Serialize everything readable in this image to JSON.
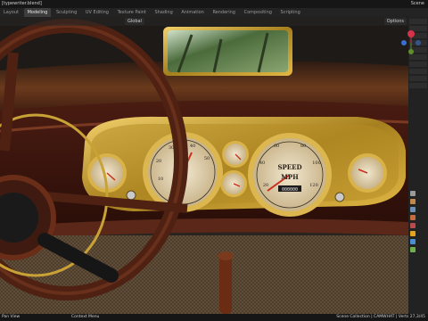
{
  "window": {
    "title": "[typewriter.blend]",
    "scene_label": "Scene"
  },
  "tabs": [
    "Layout",
    "Modeling",
    "Sculpting",
    "UV Editing",
    "Texture Paint",
    "Shading",
    "Animation",
    "Rendering",
    "Compositing",
    "Scripting"
  ],
  "active_tab": "Modeling",
  "viewport_header": {
    "orientation": "Global",
    "options": "Options"
  },
  "gauges": {
    "speed_top": "SPEED",
    "speed_bottom": "MPH",
    "odometer": "000000",
    "speed_ticks": [
      "20",
      "40",
      "60",
      "80",
      "100",
      "120"
    ],
    "left_ticks": [
      "10",
      "20",
      "30",
      "40",
      "50"
    ]
  },
  "statusbar": {
    "left": "Pan View",
    "middle": "Context Menu",
    "right": "Scene Collection | CAMWHAT | Verts 27,3/45"
  },
  "colors": {
    "accent": "#e6a31e",
    "wood": "#5a2718",
    "brass": "#c9a236"
  }
}
